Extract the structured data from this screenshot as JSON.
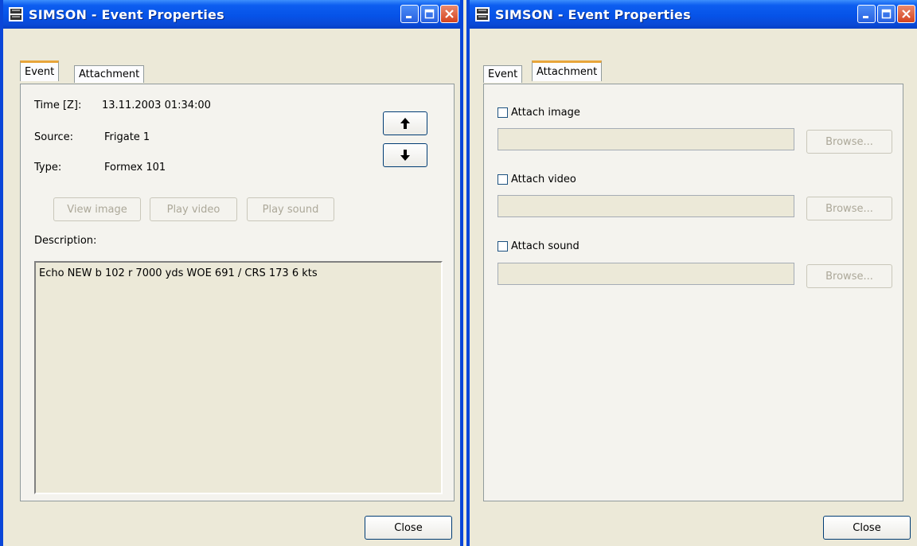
{
  "windows": [
    {
      "title": "SIMSON - Event Properties",
      "tabs": [
        {
          "label": "Event",
          "active": true
        },
        {
          "label": "Attachment",
          "active": false
        }
      ],
      "event": {
        "time_label": "Time [Z]:",
        "time_value": "13.11.2003 01:34:00",
        "source_label": "Source:",
        "source_value": "Frigate 1",
        "type_label": "Type:",
        "type_value": "Formex 101",
        "up_icon": "arrow-up-icon",
        "down_icon": "arrow-down-icon",
        "buttons": [
          "View image",
          "Play video",
          "Play sound"
        ],
        "description_label": "Description:",
        "description_text": "Echo NEW b 102 r 7000 yds WOE 691 / CRS 173 6 kts"
      },
      "close_label": "Close"
    },
    {
      "title": "SIMSON - Event Properties",
      "tabs": [
        {
          "label": "Event",
          "active": false
        },
        {
          "label": "Attachment",
          "active": true
        }
      ],
      "attachment": {
        "image": {
          "label": "Attach image",
          "checked": false,
          "value": "",
          "browse": "Browse..."
        },
        "video": {
          "label": "Attach video",
          "checked": false,
          "value": "",
          "browse": "Browse..."
        },
        "sound": {
          "label": "Attach sound",
          "checked": false,
          "value": "",
          "browse": "Browse..."
        }
      },
      "close_label": "Close"
    }
  ],
  "icons": {
    "app": "simson-logo-icon",
    "minimize": "minimize-icon",
    "maximize": "maximize-icon",
    "close": "close-icon"
  },
  "colors": {
    "titlebar": "#0653e8",
    "window_bg": "#ece9d8",
    "tab_accent": "#e8a53a",
    "close_button": "#d4431f"
  }
}
